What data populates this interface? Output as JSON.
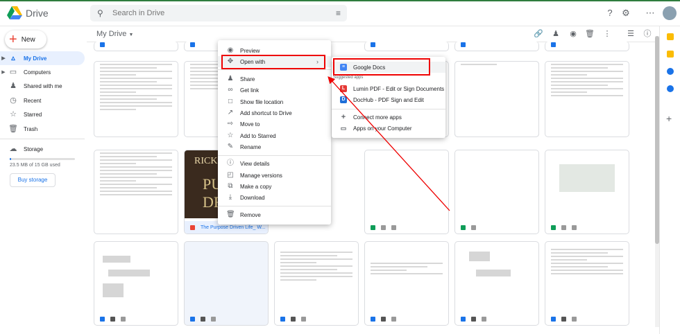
{
  "app": {
    "name": "Drive"
  },
  "search": {
    "placeholder": "Search in Drive"
  },
  "sidebar": {
    "new_label": "New",
    "items": [
      {
        "label": "My Drive",
        "icon": "drive-icon",
        "active": true
      },
      {
        "label": "Computers",
        "icon": "computer-icon",
        "active": false
      },
      {
        "label": "Shared with me",
        "icon": "people-icon",
        "active": false
      },
      {
        "label": "Recent",
        "icon": "clock-icon",
        "active": false
      },
      {
        "label": "Starred",
        "icon": "star-icon",
        "active": false
      },
      {
        "label": "Trash",
        "icon": "trash-icon",
        "active": false
      }
    ],
    "storage_label": "Storage",
    "storage_used": "23.5 MB of 15 GB used",
    "storage_fraction": 0.0016,
    "buy_storage": "Buy storage"
  },
  "main": {
    "breadcrumb": "My Drive",
    "file_name": "The Purpose Driven Life_ W...",
    "book_text": [
      "RICK",
      "PU",
      "DR"
    ]
  },
  "context_menu": {
    "items": [
      {
        "label": "Preview",
        "icon": "eye-icon"
      },
      {
        "label": "Open with",
        "icon": "move-arrows-icon",
        "submenu": true
      },
      {
        "label": "Share",
        "icon": "person-add-icon"
      },
      {
        "label": "Get link",
        "icon": "link-icon"
      },
      {
        "label": "Show file location",
        "icon": "folder-icon"
      },
      {
        "label": "Add shortcut to Drive",
        "icon": "shortcut-icon"
      },
      {
        "label": "Move to",
        "icon": "move-folder-icon"
      },
      {
        "label": "Add to Starred",
        "icon": "star-icon"
      },
      {
        "label": "Rename",
        "icon": "pencil-icon"
      },
      {
        "label": "View details",
        "icon": "info-icon"
      },
      {
        "label": "Manage versions",
        "icon": "versions-icon"
      },
      {
        "label": "Make a copy",
        "icon": "copy-icon"
      },
      {
        "label": "Download",
        "icon": "download-icon"
      },
      {
        "label": "Remove",
        "icon": "trash-icon"
      }
    ]
  },
  "open_with_submenu": {
    "primary": "Google Docs",
    "section_label": "Suggested apps",
    "apps": [
      "Lumin PDF - Edit or Sign Documents",
      "DocHub - PDF Sign and Edit"
    ],
    "more": [
      "Connect more apps",
      "Apps on your Computer"
    ]
  },
  "colors": {
    "accent": "#1a73e8",
    "highlight_box": "#e00000",
    "active_bg": "#e8f0fe"
  }
}
